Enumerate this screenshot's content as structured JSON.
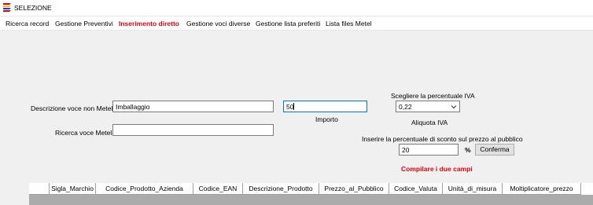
{
  "window": {
    "title": "SELEZIONE",
    "icon": "app-stripes-icon"
  },
  "menu": {
    "items": [
      {
        "label": "Ricerca record",
        "active": false
      },
      {
        "label": "Gestione Preventivi",
        "active": false
      },
      {
        "label": "Inserimento diretto",
        "active": true
      },
      {
        "label": "Gestione voci diverse",
        "active": false
      },
      {
        "label": "Gestione lista preferiti",
        "active": false
      },
      {
        "label": "Lista files Metel",
        "active": false
      }
    ]
  },
  "form": {
    "descrizione_label": "Descrizione voce non Metel",
    "descrizione_value": "Imballaggio",
    "importo_value": "50",
    "importo_label": "Importo",
    "ricerca_label": "Ricerca voce Metel",
    "ricerca_value": "",
    "iva_label": "Scegliere la percentuale IVA",
    "iva_selected": "0,22",
    "aliquota_label": "Aliquota IVA",
    "sconto_label": "Inserire la percentuale di sconto sul prezzo al pubblico",
    "sconto_value": "20",
    "percent_symbol": "%",
    "conferma_label": "Conferma",
    "warning": "Compilare i due campi"
  },
  "grid": {
    "columns": [
      "Sigla_Marchio",
      "Codice_Prodotto_Azienda",
      "Codice_EAN",
      "Descrizione_Prodotto",
      "Prezzo_al_Pubblico",
      "Codice_Valuta",
      "Unità_di_misura",
      "Moltiplicatore_prezzo"
    ]
  },
  "colors": {
    "accent_red": "#e0000f",
    "background": "#f0f0f0",
    "focus_border": "#0078d7"
  }
}
